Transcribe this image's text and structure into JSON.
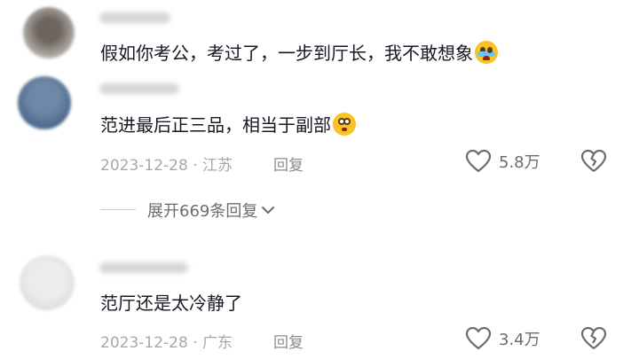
{
  "comments": [
    {
      "text": "假如你考公，考过了，一步到厅长，我不敢想象",
      "emoji": "loudly-crying-face"
    },
    {
      "text": "范进最后正三品，相当于副部",
      "emoji": "flushed-face",
      "meta": "2023-12-28 · 江苏",
      "reply_label": "回复",
      "likes": "5.8万"
    },
    {
      "text": "范厅还是太冷静了",
      "meta": "2023-12-28 · 广东",
      "reply_label": "回复",
      "likes": "3.4万"
    }
  ],
  "expand_replies_label": "展开669条回复",
  "colors": {
    "text": "#161823",
    "meta": "#a7a8ac",
    "secondary": "#6b6c72"
  }
}
